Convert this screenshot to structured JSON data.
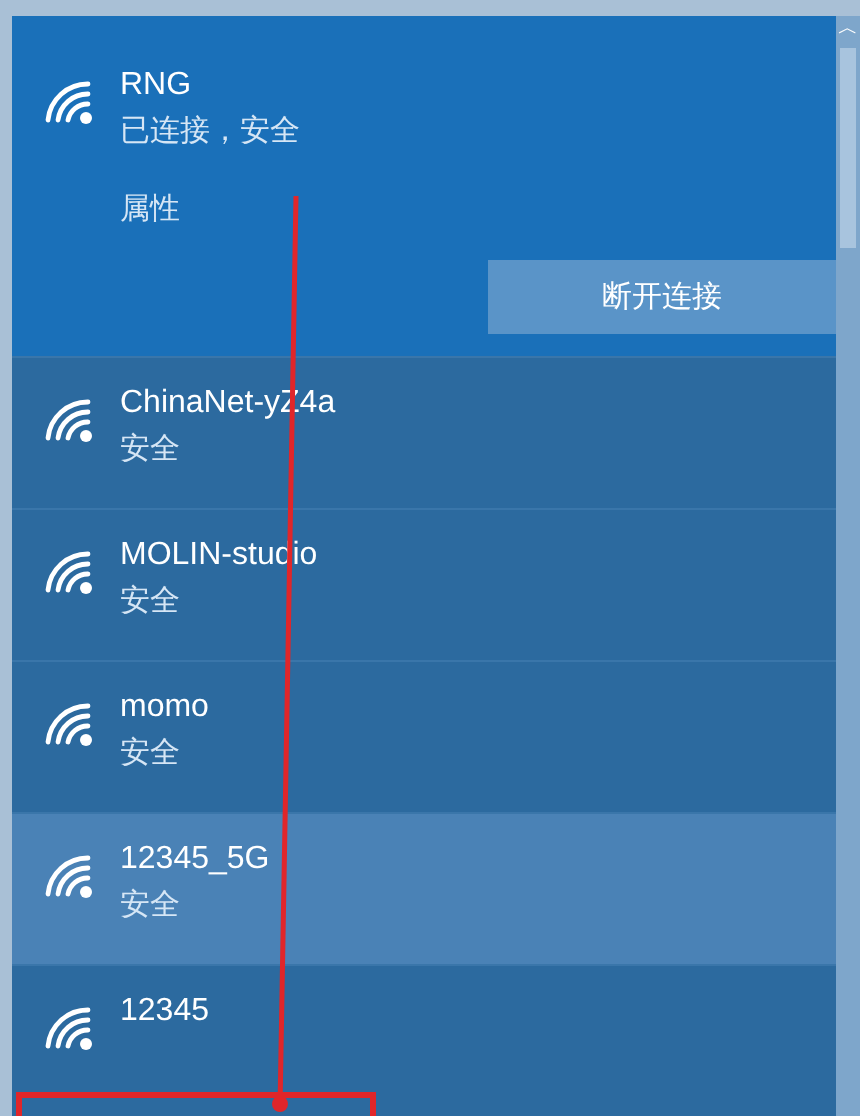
{
  "connected": {
    "name": "RNG",
    "status": "已连接，安全",
    "properties": "属性",
    "disconnect_button": "断开连接"
  },
  "networks": [
    {
      "name": "ChinaNet-yZ4a",
      "security": "安全",
      "highlighted": false
    },
    {
      "name": "MOLIN-studio",
      "security": "安全",
      "highlighted": false
    },
    {
      "name": "momo",
      "security": "安全",
      "highlighted": false
    },
    {
      "name": "12345_5G",
      "security": "安全",
      "highlighted": true
    },
    {
      "name": "12345",
      "highlighted": false
    }
  ],
  "scrollbar": {
    "up_arrow": "︿"
  }
}
